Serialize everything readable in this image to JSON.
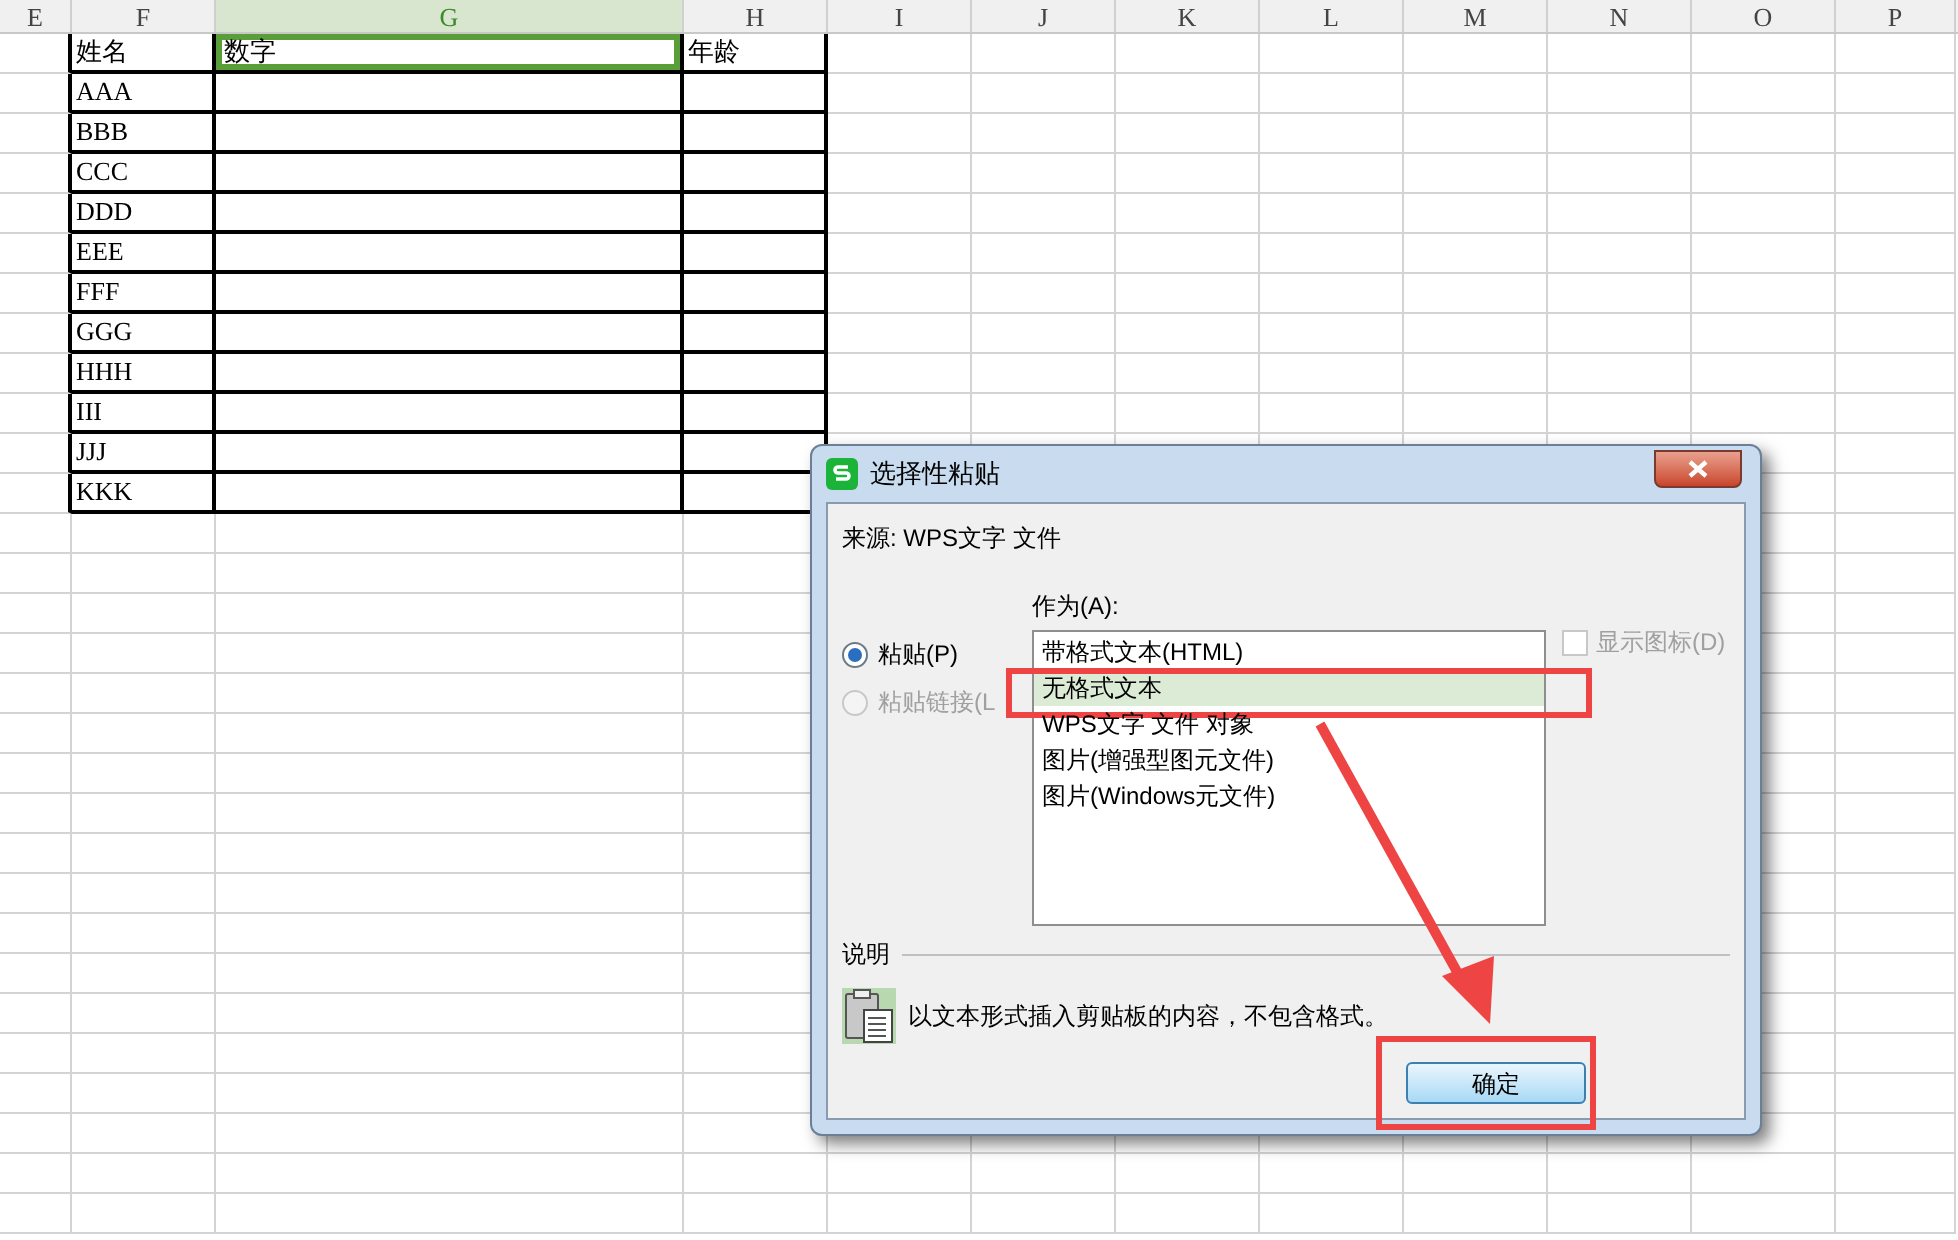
{
  "sheet": {
    "columns": [
      {
        "label": "E",
        "selected": false
      },
      {
        "label": "F",
        "selected": false
      },
      {
        "label": "G",
        "selected": true
      },
      {
        "label": "H",
        "selected": false
      },
      {
        "label": "I",
        "selected": false
      },
      {
        "label": "J",
        "selected": false
      },
      {
        "label": "K",
        "selected": false
      },
      {
        "label": "L",
        "selected": false
      },
      {
        "label": "M",
        "selected": false
      },
      {
        "label": "N",
        "selected": false
      },
      {
        "label": "O",
        "selected": false
      },
      {
        "label": "P",
        "selected": false
      }
    ],
    "header": [
      {
        "text": "姓名",
        "selected": false
      },
      {
        "text": "数字",
        "selected": true
      },
      {
        "text": "年龄",
        "selected": false
      }
    ],
    "rows": [
      "AAA",
      "BBB",
      "CCC",
      "DDD",
      "EEE",
      "FFF",
      "GGG",
      "HHH",
      "III",
      "JJJ",
      "KKK"
    ]
  },
  "dialog": {
    "title": "选择性粘贴",
    "source": "来源: WPS文字 文件",
    "paste_modes": [
      {
        "label": "粘贴(P)",
        "selected": true,
        "disabled": false
      },
      {
        "label": "粘贴链接(L",
        "selected": false,
        "disabled": true
      }
    ],
    "as_label": "作为(A):",
    "formats": [
      {
        "label": "带格式文本(HTML)",
        "selected": false
      },
      {
        "label": "无格式文本",
        "selected": true
      },
      {
        "label": "WPS文字 文件 对象",
        "selected": false
      },
      {
        "label": "图片(增强型图元文件)",
        "selected": false
      },
      {
        "label": "图片(Windows元文件)",
        "selected": false
      }
    ],
    "show_icon": {
      "label": "显示图标(D)",
      "checked": false,
      "disabled": true
    },
    "description_label": "说明",
    "description": "以文本形式插入剪贴板的内容，不包含格式。",
    "buttons": [
      "确定"
    ]
  }
}
